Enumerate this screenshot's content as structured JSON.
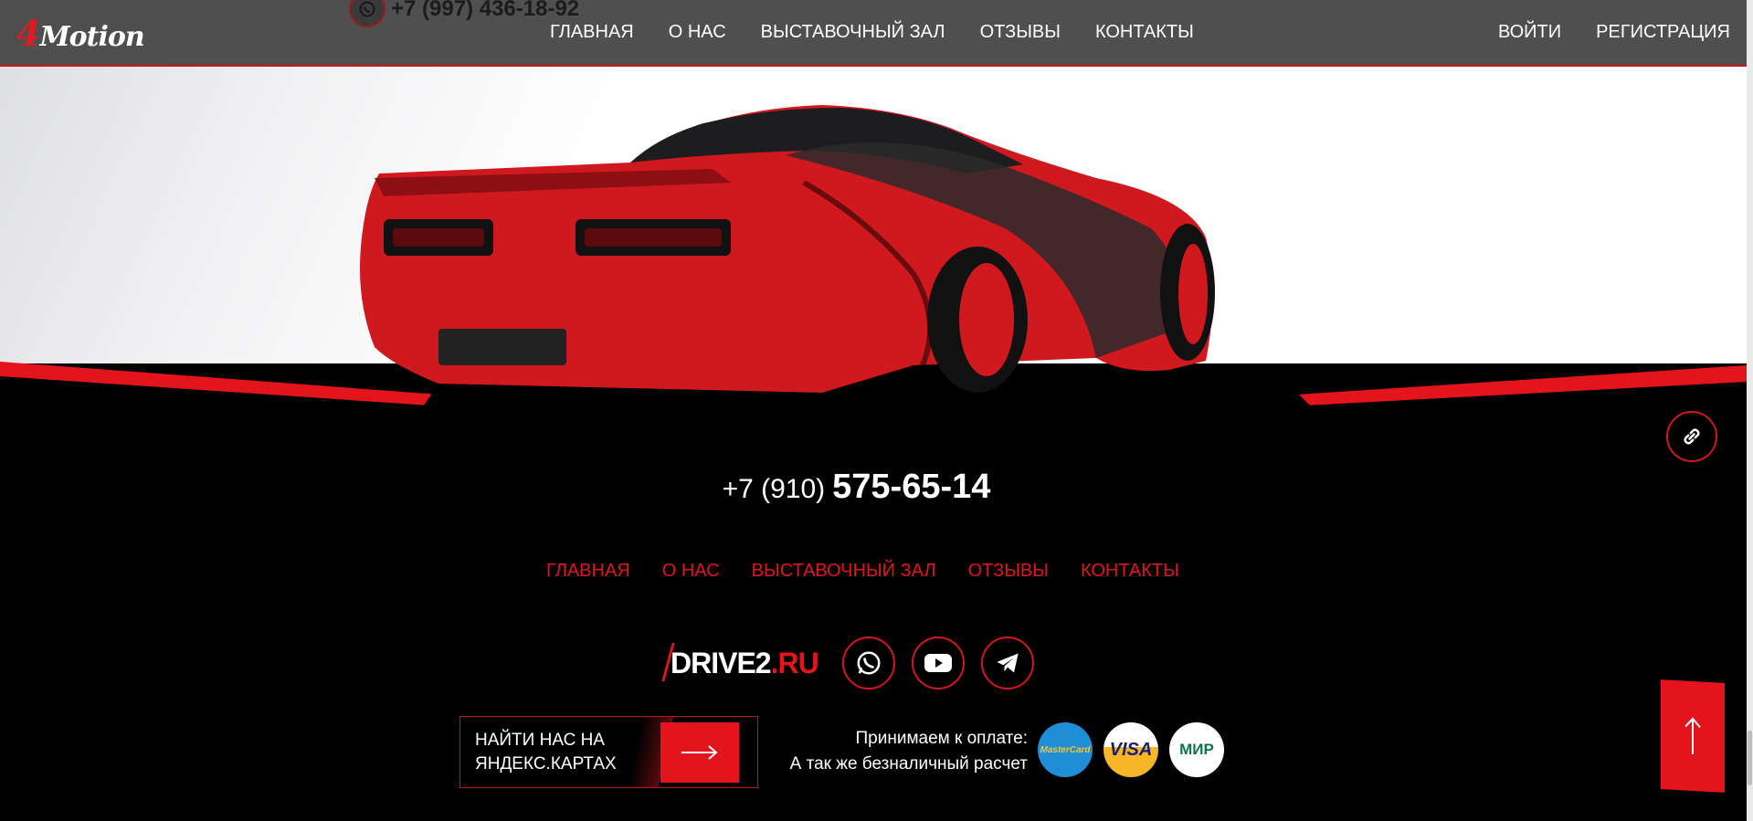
{
  "header": {
    "logo_text": "Motion",
    "logo_digit": "4",
    "phone": "+7 (997) 436-18-92",
    "nav": [
      "ГЛАВНАЯ",
      "О НАС",
      "ВЫСТАВОЧНЫЙ ЗАЛ",
      "ОТЗЫВЫ",
      "КОНТАКТЫ"
    ],
    "login": "ВОЙТИ",
    "register": "РЕГИСТРАЦИЯ"
  },
  "footer": {
    "phone_prefix": "+7 (910)",
    "phone_number": "575-65-14",
    "nav": [
      "ГЛАВНАЯ",
      "О НАС",
      "ВЫСТАВОЧНЫЙ ЗАЛ",
      "ОТЗЫВЫ",
      "КОНТАКТЫ"
    ],
    "drive2_main": "DRIVE2",
    "drive2_domain": ".RU",
    "socials": [
      "whatsapp-icon",
      "youtube-icon",
      "telegram-icon"
    ],
    "map_button_line1": "НАЙТИ НАС НА",
    "map_button_line2": "ЯНДЕКС.КАРТАХ",
    "payment_line1": "Принимаем к оплате:",
    "payment_line2": "А так же безналичный расчет",
    "cards": {
      "mastercard": "MasterCard",
      "visa": "VISA",
      "mir": "МИР"
    }
  },
  "colors": {
    "accent": "#e3141c",
    "header_bg": "#484848",
    "footer_bg": "#000000"
  }
}
